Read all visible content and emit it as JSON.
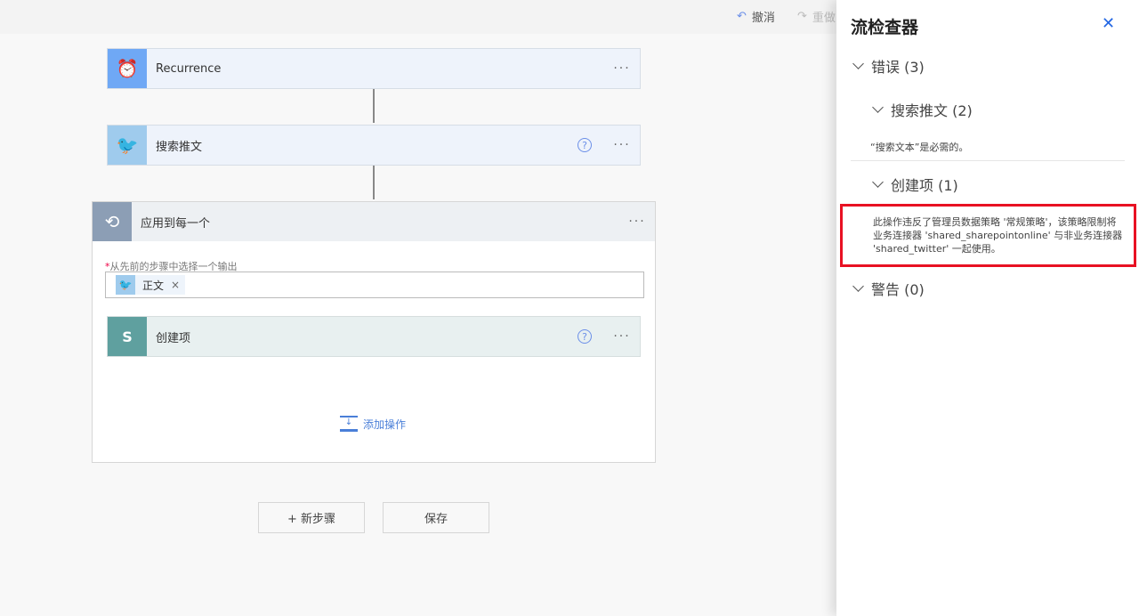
{
  "toolbar": {
    "undo": "撤消",
    "redo": "重做"
  },
  "steps": {
    "recurrence": "Recurrence",
    "search_tweets": "搜索推文",
    "apply_each": "应用到每一个",
    "select_output_label": "从先前的步骤中选择一个输出",
    "required_mark": "*",
    "token": "正文",
    "token_remove": "×",
    "create_item": "创建项",
    "add_action": "添加操作",
    "more": "···",
    "help": "?"
  },
  "buttons": {
    "new_step": "+ 新步骤",
    "save": "保存"
  },
  "checker": {
    "title": "流检查器",
    "close": "✕",
    "errors": "错误 (3)",
    "search_group": "搜索推文 (2)",
    "search_msg": "“搜索文本”是必需的。",
    "create_group": "创建项 (1)",
    "create_msg": "此操作违反了管理员数据策略 '常规策略'，该策略限制将业务连接器 'shared_sharepointonline' 与非业务连接器 'shared_twitter' 一起使用。",
    "warnings": "警告 (0)"
  },
  "colors": {
    "accent": "#2266e3",
    "highlight": "#e81123"
  }
}
